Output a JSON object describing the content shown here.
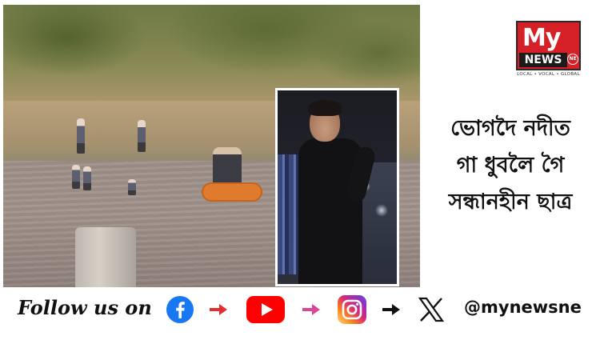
{
  "logo": {
    "brand_top": "My",
    "brand_bottom": "NEWS",
    "badge": "NE",
    "tagline": "LOCAL • VOCAL • GLOBAL",
    "colors": {
      "red": "#d62027",
      "black": "#1b1b1b"
    }
  },
  "headline": {
    "lines": [
      "ভোগদৈ নদীত",
      "গা ধুবলৈ গৈ",
      "সন্ধানহীন ছাত্ৰ"
    ]
  },
  "social": {
    "follow_text": "Follow us on",
    "handle": "@mynewsne",
    "icons": [
      "facebook-icon",
      "youtube-icon",
      "instagram-icon",
      "x-icon"
    ],
    "arrow_colors": [
      "#e03030",
      "#e03030",
      "#d6479a",
      "#111111"
    ],
    "brand_colors": {
      "facebook": "#1877f2",
      "youtube": "#ff0000",
      "instagram": "#c13584",
      "x": "#111111"
    }
  }
}
